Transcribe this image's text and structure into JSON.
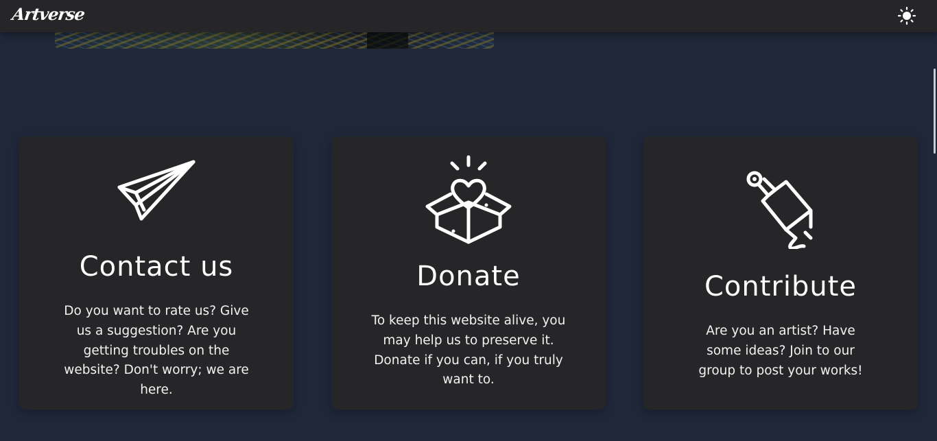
{
  "header": {
    "logo": "Artverse",
    "theme_toggle_icon": "sun-icon"
  },
  "cards": [
    {
      "icon": "paper-plane-icon",
      "title": "Contact us",
      "text": "Do you want to rate us? Give us a suggestion? Are you getting troubles on the website? Don't worry; we are here."
    },
    {
      "icon": "heart-box-icon",
      "title": "Donate",
      "text": "To keep this website alive, you may help us to preserve it. Donate if you can, if you truly want to."
    },
    {
      "icon": "paint-brush-icon",
      "title": "Contribute",
      "text": "Are you an artist? Have some ideas? Join to our group to post your works!"
    }
  ],
  "colors": {
    "page_background": "#1f2739",
    "card_background": "#262628",
    "header_background": "#262628",
    "text": "#ffffff"
  }
}
